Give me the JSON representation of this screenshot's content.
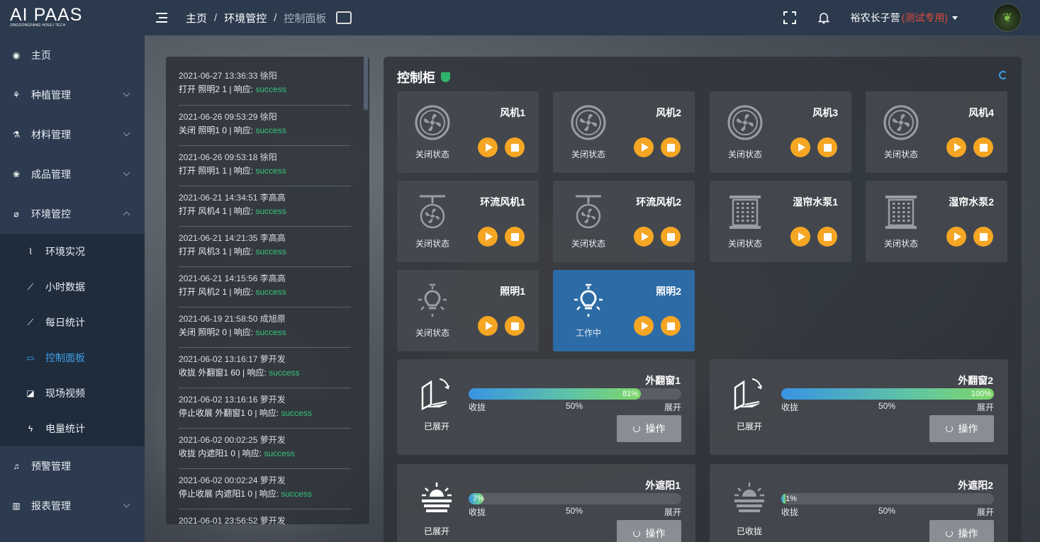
{
  "app": {
    "logo_main": "AI PAAS",
    "logo_sub": "JINGDONGFANG HOULI TECH"
  },
  "breadcrumb": {
    "home": "主页",
    "section": "环境管控",
    "current": "控制面板"
  },
  "user": {
    "name": "裕农长子营",
    "tag": "(测试专用)"
  },
  "sidebar": {
    "items": [
      {
        "label": "主页"
      },
      {
        "label": "种植管理"
      },
      {
        "label": "材料管理"
      },
      {
        "label": "成品管理"
      },
      {
        "label": "环境管控"
      }
    ],
    "subitems": [
      {
        "label": "环境实况"
      },
      {
        "label": "小时数据"
      },
      {
        "label": "每日统计"
      },
      {
        "label": "控制面板"
      },
      {
        "label": "现场视频"
      },
      {
        "label": "电量统计"
      }
    ],
    "bottom": [
      {
        "label": "预警管理"
      },
      {
        "label": "报表管理"
      }
    ]
  },
  "logs": [
    {
      "time": "2021-06-27 13:36:33 徐阳",
      "action": "打开 照明2 1 | 响应: ",
      "result": "success"
    },
    {
      "time": "2021-06-26 09:53:29 徐阳",
      "action": "关闭 照明1 0 | 响应: ",
      "result": "success"
    },
    {
      "time": "2021-06-26 09:53:18 徐阳",
      "action": "打开 照明1 1 | 响应: ",
      "result": "success"
    },
    {
      "time": "2021-06-21 14:34:51 李高高",
      "action": "打开 风机4 1 | 响应: ",
      "result": "success"
    },
    {
      "time": "2021-06-21 14:21:35 李高高",
      "action": "打开 风机3 1 | 响应: ",
      "result": "success"
    },
    {
      "time": "2021-06-21 14:15:56 李高高",
      "action": "打开 风机2 1 | 响应: ",
      "result": "success"
    },
    {
      "time": "2021-06-19 21:58:50 成旭原",
      "action": "关闭 照明2 0 | 响应: ",
      "result": "success"
    },
    {
      "time": "2021-06-02 13:16:17 萝开发",
      "action": "收拢 外翻窗1 60 | 响应: ",
      "result": "success"
    },
    {
      "time": "2021-06-02 13:16:16 萝开发",
      "action": "停止收展 外翻窗1 0 | 响应: ",
      "result": "success"
    },
    {
      "time": "2021-06-02 00:02:25 萝开发",
      "action": "收拢 内遮阳1 0 | 响应: ",
      "result": "success"
    },
    {
      "time": "2021-06-02 00:02:24 萝开发",
      "action": "停止收展 内遮阳1 0 | 响应: ",
      "result": "success"
    },
    {
      "time": "2021-06-01 23:56:52 萝开发",
      "action": "",
      "result": ""
    }
  ],
  "panel": {
    "title": "控制柜"
  },
  "devices": [
    {
      "name": "风机1",
      "state": "关闭状态",
      "kind": "fan",
      "on": false
    },
    {
      "name": "风机2",
      "state": "关闭状态",
      "kind": "fan",
      "on": false
    },
    {
      "name": "风机3",
      "state": "关闭状态",
      "kind": "fan",
      "on": false
    },
    {
      "name": "风机4",
      "state": "关闭状态",
      "kind": "fan",
      "on": false
    },
    {
      "name": "环流风机1",
      "state": "关闭状态",
      "kind": "circ",
      "on": false
    },
    {
      "name": "环流风机2",
      "state": "关闭状态",
      "kind": "circ",
      "on": false
    },
    {
      "name": "湿帘水泵1",
      "state": "关闭状态",
      "kind": "pump",
      "on": false
    },
    {
      "name": "湿帘水泵2",
      "state": "关闭状态",
      "kind": "pump",
      "on": false
    },
    {
      "name": "照明1",
      "state": "关闭状态",
      "kind": "light",
      "on": false
    },
    {
      "name": "照明2",
      "state": "工作中",
      "kind": "light",
      "on": true
    }
  ],
  "windows": [
    {
      "name": "外翻窗1",
      "state": "已展开",
      "percent": 81,
      "pct_label": "81%",
      "kind": "window",
      "bright": true
    },
    {
      "name": "外翻窗2",
      "state": "已展开",
      "percent": 100,
      "pct_label": "100%",
      "kind": "window",
      "bright": true
    },
    {
      "name": "外遮阳1",
      "state": "已展开",
      "percent": 7,
      "pct_label": "7%",
      "kind": "shade",
      "bright": true
    },
    {
      "name": "外遮阳2",
      "state": "已收拢",
      "percent": 1,
      "pct_label": "1%",
      "kind": "shade",
      "bright": false
    }
  ],
  "scale": {
    "min": "收拢",
    "mid": "50%",
    "max": "展开"
  },
  "op_label": "操作",
  "colors": {
    "accent": "#3f9ee8",
    "success": "#36c47b",
    "button": "#f5a623",
    "danger": "#e34b3c",
    "active_card": "#2d6ba6"
  }
}
